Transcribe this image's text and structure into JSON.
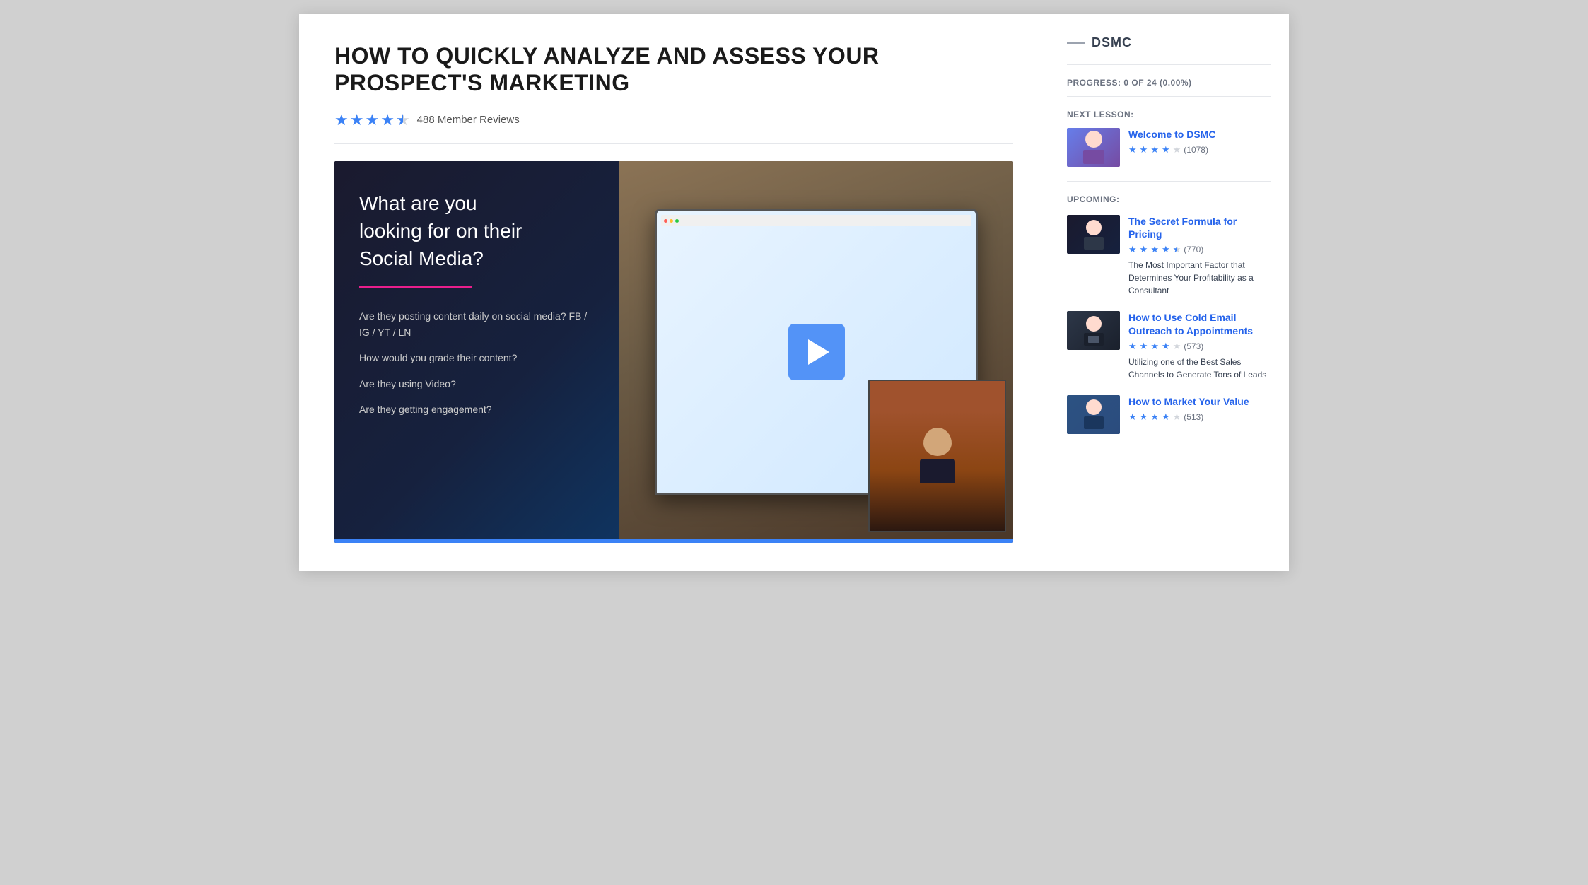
{
  "main": {
    "title": "HOW TO QUICKLY ANALYZE AND ASSESS YOUR PROSPECT'S MARKETING",
    "review_count": "488 Member Reviews",
    "stars": 4.5,
    "video": {
      "left_title": "What are you looking for on their Social Media?",
      "bullets": [
        "Are they posting content daily on social media? FB / IG / YT / LN",
        "How would you grade their content?",
        "Are they using Video?",
        "Are they getting engagement?"
      ]
    }
  },
  "sidebar": {
    "brand": "DSMC",
    "progress_text": "PROGRESS: 0 OF 24 (0.00%)",
    "next_lesson_label": "NEXT LESSON:",
    "upcoming_label": "UPCOMING:",
    "next_lesson": {
      "title": "Welcome to DSMC",
      "stars": 4,
      "rating_count": "(1078)"
    },
    "upcoming": [
      {
        "title": "The Secret Formula for Pricing",
        "stars": 4.5,
        "rating_count": "(770)",
        "description": "The Most Important Factor that Determines Your Profitability as a Consultant"
      },
      {
        "title": "How to Use Cold Email Outreach to Appointments",
        "stars": 4,
        "rating_count": "(573)",
        "description": "Utilizing one of the Best Sales Channels to Generate Tons of Leads"
      },
      {
        "title": "How to Market Your Value",
        "stars": 4,
        "rating_count": "(513)",
        "description": ""
      }
    ]
  }
}
